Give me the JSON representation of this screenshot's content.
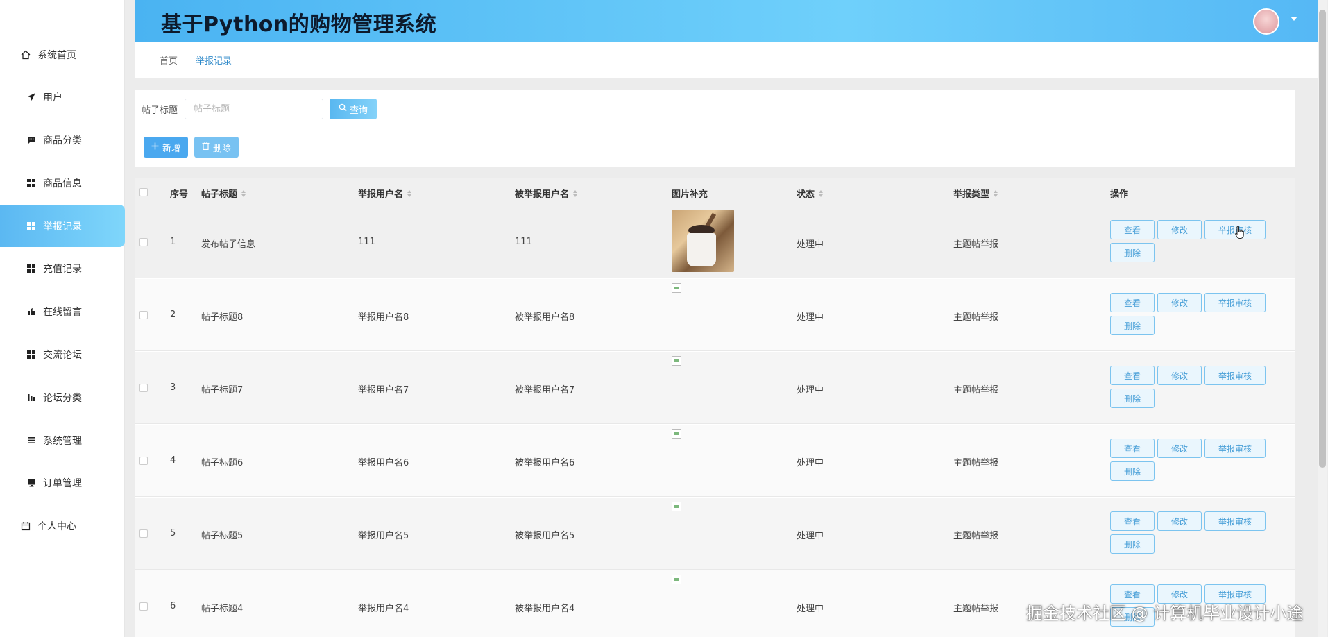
{
  "app": {
    "title": "基于Python的购物管理系统"
  },
  "sidebar": {
    "items": [
      {
        "label": "系统首页",
        "icon": "home-icon"
      },
      {
        "label": "用户",
        "icon": "send-icon"
      },
      {
        "label": "商品分类",
        "icon": "chat-icon"
      },
      {
        "label": "商品信息",
        "icon": "grid-icon"
      },
      {
        "label": "举报记录",
        "icon": "grid-icon",
        "active": true
      },
      {
        "label": "充值记录",
        "icon": "grid-icon"
      },
      {
        "label": "在线留言",
        "icon": "thumb-icon"
      },
      {
        "label": "交流论坛",
        "icon": "grid-icon"
      },
      {
        "label": "论坛分类",
        "icon": "bars-icon"
      },
      {
        "label": "系统管理",
        "icon": "list-icon"
      },
      {
        "label": "订单管理",
        "icon": "monitor-icon"
      },
      {
        "label": "个人中心",
        "icon": "calendar-icon"
      }
    ]
  },
  "breadcrumb": {
    "home": "首页",
    "current": "举报记录"
  },
  "filter": {
    "label": "帖子标题",
    "placeholder": "帖子标题",
    "value": "",
    "search_label": "查询",
    "add_label": "新增",
    "delete_label": "删除"
  },
  "table": {
    "headers": {
      "index": "序号",
      "title": "帖子标题",
      "reporter": "举报用户名",
      "reported": "被举报用户名",
      "image": "图片补充",
      "status": "状态",
      "type": "举报类型",
      "actions": "操作"
    },
    "rows": [
      {
        "index": "1",
        "title": "发布帖子信息",
        "reporter": "111",
        "reported": "111",
        "image": "photo",
        "status": "处理中",
        "type": "主题帖举报"
      },
      {
        "index": "2",
        "title": "帖子标题8",
        "reporter": "举报用户名8",
        "reported": "被举报用户名8",
        "image": "broken",
        "status": "处理中",
        "type": "主题帖举报"
      },
      {
        "index": "3",
        "title": "帖子标题7",
        "reporter": "举报用户名7",
        "reported": "被举报用户名7",
        "image": "broken",
        "status": "处理中",
        "type": "主题帖举报"
      },
      {
        "index": "4",
        "title": "帖子标题6",
        "reporter": "举报用户名6",
        "reported": "被举报用户名6",
        "image": "broken",
        "status": "处理中",
        "type": "主题帖举报"
      },
      {
        "index": "5",
        "title": "帖子标题5",
        "reporter": "举报用户名5",
        "reported": "被举报用户名5",
        "image": "broken",
        "status": "处理中",
        "type": "主题帖举报"
      },
      {
        "index": "6",
        "title": "帖子标题4",
        "reporter": "举报用户名4",
        "reported": "被举报用户名4",
        "image": "broken",
        "status": "处理中",
        "type": "主题帖举报"
      }
    ],
    "actions": {
      "view": "查看",
      "edit": "修改",
      "audit": "举报审核",
      "delete": "删除"
    }
  },
  "watermark": "掘金技术社区 @ 计算机毕业设计小途",
  "colors": {
    "accent": "#4aa8ef",
    "header_gradient_start": "#4ab3f2",
    "header_gradient_end": "#6fd0fb",
    "active_link": "#2e89c9"
  }
}
